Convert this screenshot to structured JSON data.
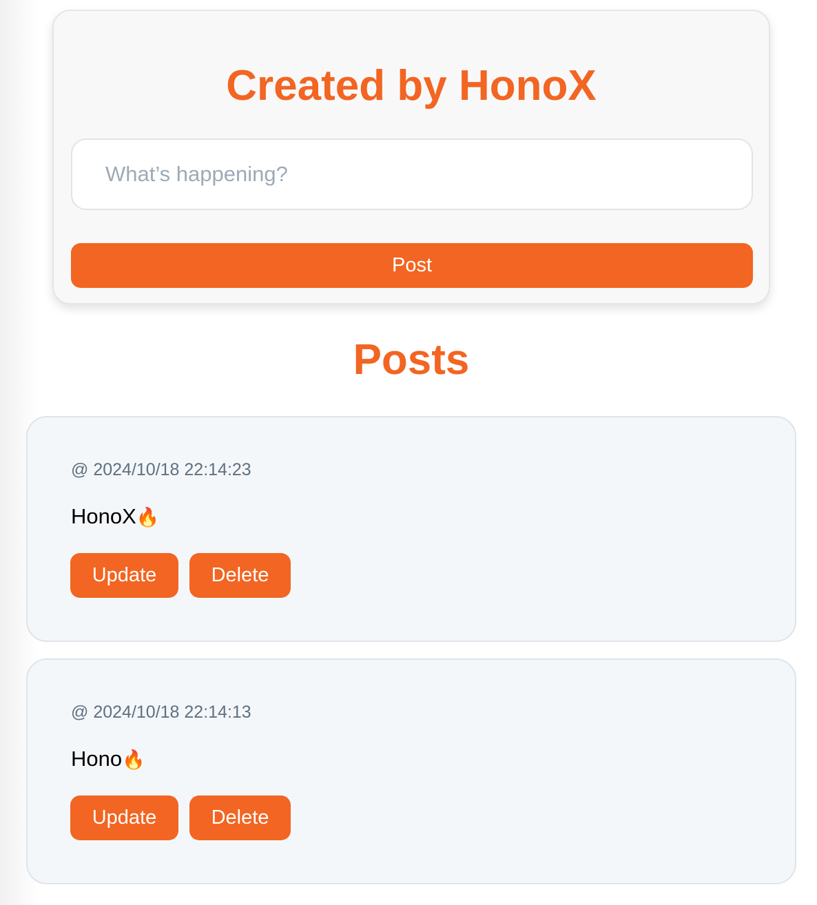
{
  "composer": {
    "title": "Created by HonoX",
    "input_placeholder": "What’s happening?",
    "input_value": "",
    "post_label": "Post"
  },
  "posts_heading": "Posts",
  "posts": [
    {
      "timestamp": "@ 2024/10/18 22:14:23",
      "text": "HonoX",
      "emoji": "🔥",
      "update_label": "Update",
      "delete_label": "Delete"
    },
    {
      "timestamp": "@ 2024/10/18 22:14:13",
      "text": "Hono",
      "emoji": "🔥",
      "update_label": "Update",
      "delete_label": "Delete"
    }
  ],
  "colors": {
    "accent": "#f26522",
    "card_background": "#f4f7fa",
    "composer_background": "#f8f8f8",
    "timestamp": "#5f7080",
    "placeholder": "#9daab6"
  },
  "icons": {
    "post_emoji": "fire-icon"
  }
}
